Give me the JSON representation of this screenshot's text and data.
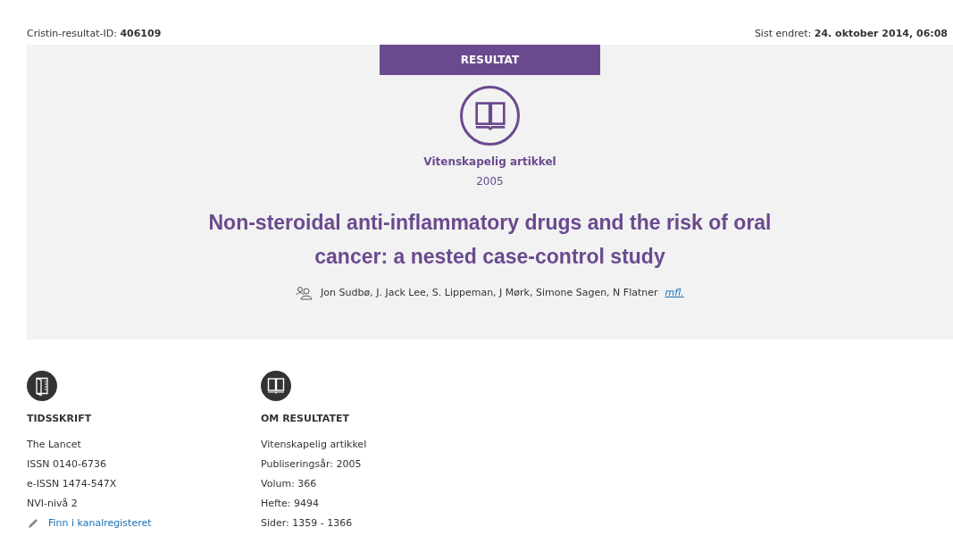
{
  "header": {
    "result_id": "Cristin-resultat-ID: **406109**",
    "last_modified": "Sist endret: **24. oktober 2014, 06:08**"
  },
  "hero": {
    "badge": "RESULTAT",
    "category": "Vitenskapelig artikkel",
    "year": "2005",
    "title": "Non-steroidal anti-inflammatory drugs and the risk of oral cancer: a nested case-control study",
    "authors": "Jon Sudbø, J. Jack Lee, S. Lippeman, J Mørk, Simone Sagen, N Flatner",
    "more_link": "mfl."
  },
  "sections": [
    {
      "kind": "journal",
      "heading": "TIDSSKRIFT",
      "lines": [
        "The Lancet",
        "ISSN 0140-6736",
        "e-ISSN 1474-547X",
        "NVI-nivå 2"
      ],
      "link": "Finn i kanalregisteret"
    },
    {
      "kind": "result",
      "heading": "OM RESULTATET",
      "lines": [
        "Vitenskapelig artikkel",
        "Publiseringsår: 2005",
        "Volum: 366",
        "Hefte: 9494",
        "Sider: 1359 - 1366"
      ]
    }
  ]
}
